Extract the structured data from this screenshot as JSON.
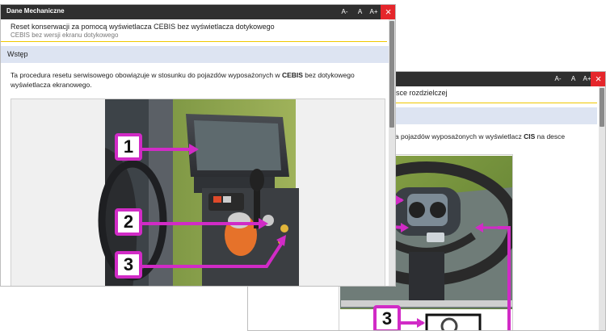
{
  "window_back": {
    "title": "",
    "font_smaller": "A-",
    "font_normal": "A",
    "font_larger": "A+",
    "close_symbol": "×",
    "doc_title": "esce rozdzielczej",
    "para": "la pojazdów wyposażonych w wyświetlacz ",
    "para_bold": "CIS",
    "para_end": " na desce",
    "callout_3": "3"
  },
  "window_front": {
    "title": "Dane Mechaniczne",
    "font_smaller": "A-",
    "font_normal": "A",
    "font_larger": "A+",
    "close_symbol": "×",
    "doc_title": "Reset konserwacji za pomocą wyświetlacza CEBIS bez wyświetlacza dotykowego",
    "doc_subtitle": "CEBIS bez wersji ekranu dotykowego",
    "section": "Wstęp",
    "para_start": "Ta procedura resetu serwisowego obowiązuje w stosunku do pojazdów wyposażonych w ",
    "para_bold": "CEBIS",
    "para_end": " bez dotykowego wyświetlacza ekranowego.",
    "callouts": [
      "1",
      "2",
      "3"
    ]
  },
  "colors": {
    "titlebar": "#2f2f2f",
    "close": "#e5262b",
    "accent_rule": "#f0c800",
    "section_bg": "#dde4f2",
    "callout": "#d12bc6"
  }
}
